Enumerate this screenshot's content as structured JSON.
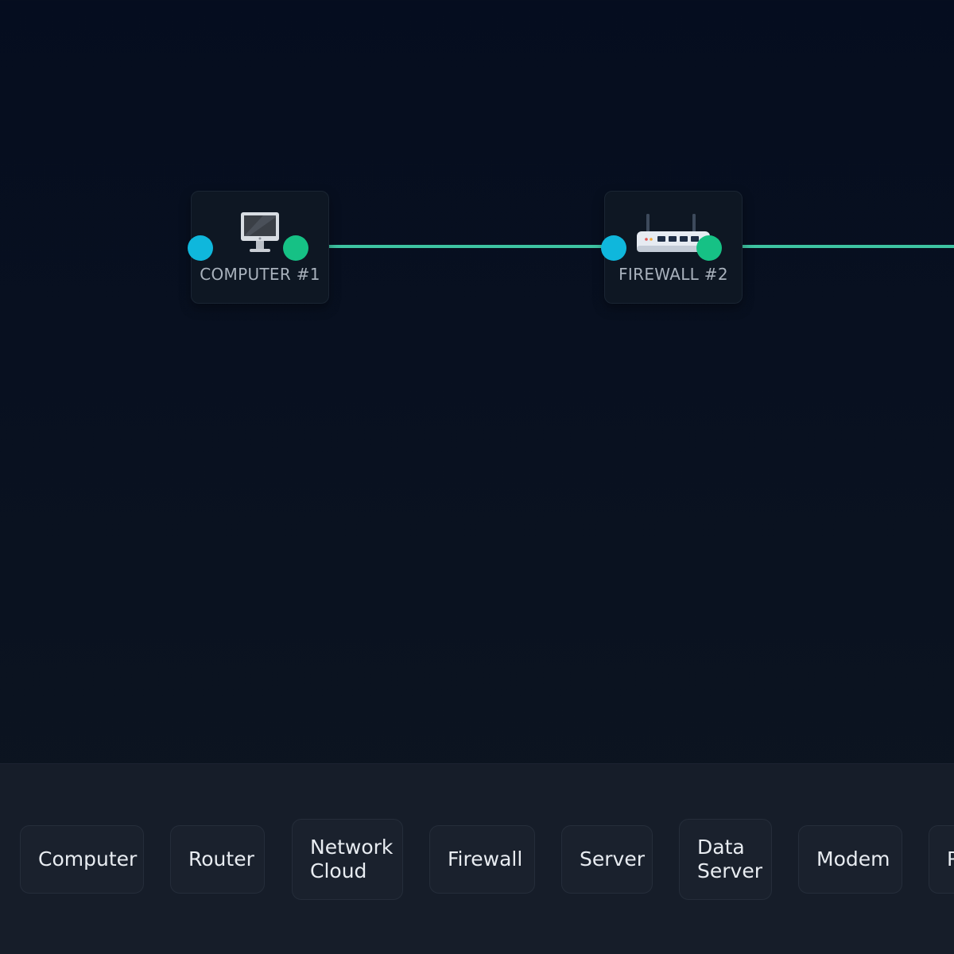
{
  "colors": {
    "background": "#060e1f",
    "link": "#3ec4a2",
    "port_in": "#0fb7dc",
    "port_out": "#16c185",
    "node_bg": "#0e1723",
    "palette_bg": "#161d29"
  },
  "canvas": {
    "nodes": [
      {
        "label": "COMPUTER #1",
        "icon": "computer-icon"
      },
      {
        "label": "FIREWALL #2",
        "icon": "router-icon"
      }
    ],
    "links": [
      {
        "from": "COMPUTER #1",
        "to": "FIREWALL #2"
      },
      {
        "from": "FIREWALL #2",
        "to": "offscreen"
      }
    ]
  },
  "palette": {
    "items": [
      {
        "label": "Computer"
      },
      {
        "label": "Router"
      },
      {
        "label": "Network\nCloud"
      },
      {
        "label": "Firewall"
      },
      {
        "label": "Server"
      },
      {
        "label": "Data\nServer"
      },
      {
        "label": "Modem"
      },
      {
        "label": "P"
      }
    ]
  }
}
